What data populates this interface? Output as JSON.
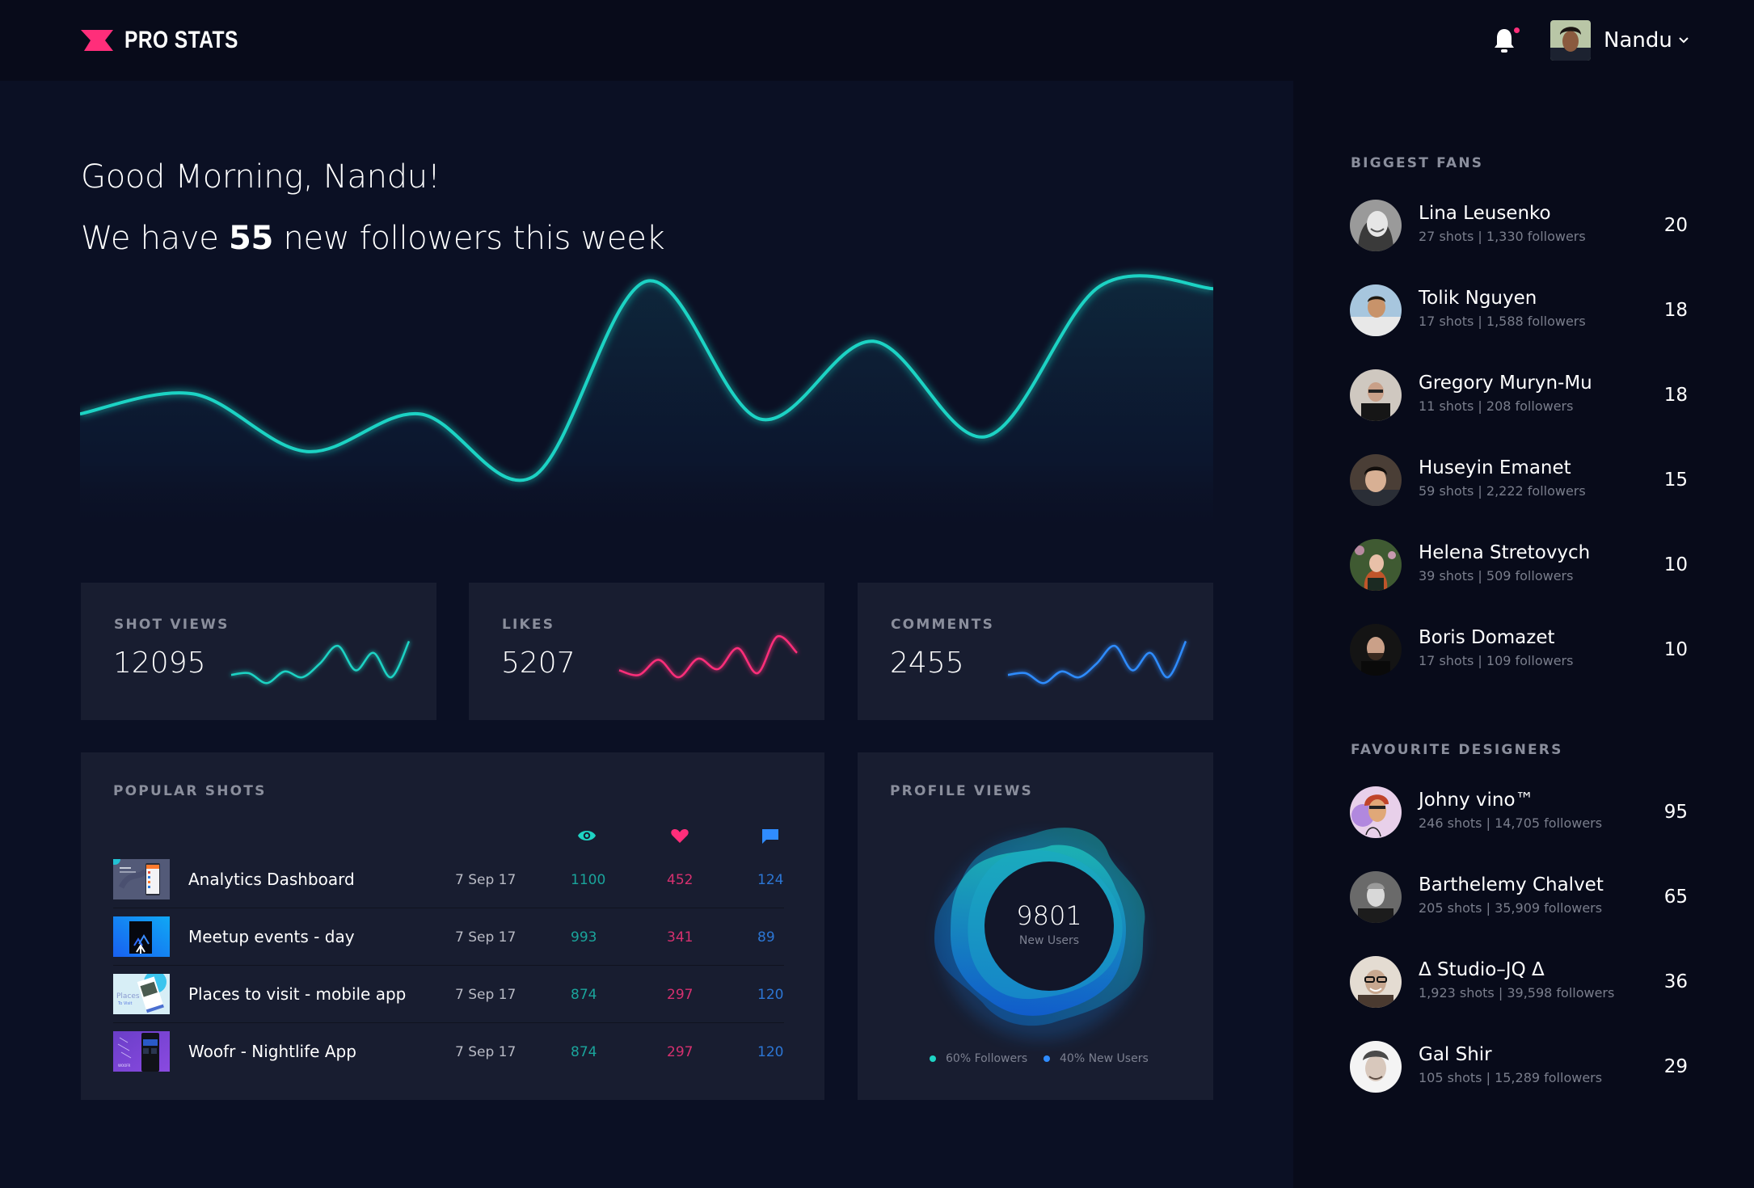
{
  "header": {
    "brand": "PRO STATS",
    "user_name": "Nandu",
    "notification_dot": true,
    "colors": {
      "brand": "#ff2e7a"
    }
  },
  "greeting": {
    "line1": "Good Morning, Nandu!",
    "line2_prefix": "We have ",
    "line2_count": "55",
    "line2_suffix": " new followers this week"
  },
  "chart_data": [
    {
      "type": "line",
      "title": "",
      "xlabel": "",
      "ylabel": "",
      "grid": false,
      "x": [
        0,
        1,
        2,
        3,
        4,
        5,
        6,
        7,
        8,
        9,
        10
      ],
      "series": [
        {
          "name": "New followers",
          "color": "#1ed3c4",
          "values": [
            38,
            46,
            23,
            38,
            13,
            91,
            36,
            67,
            29,
            89,
            88
          ]
        }
      ],
      "ylim": [
        0,
        100
      ]
    },
    {
      "type": "line",
      "title": "SHOT VIEWS",
      "series": [
        {
          "name": "Shot views",
          "color": "#1ed3c4",
          "values": [
            22,
            25,
            8,
            28,
            18,
            42,
            72,
            30,
            60,
            18,
            80
          ]
        }
      ],
      "ylim": [
        0,
        100
      ]
    },
    {
      "type": "line",
      "title": "LIKES",
      "series": [
        {
          "name": "Likes",
          "color": "#ff2e7a",
          "values": [
            30,
            22,
            48,
            18,
            50,
            32,
            68,
            25,
            88,
            60
          ]
        }
      ],
      "ylim": [
        0,
        100
      ]
    },
    {
      "type": "line",
      "title": "COMMENTS",
      "series": [
        {
          "name": "Comments",
          "color": "#2f8cff",
          "values": [
            22,
            25,
            8,
            28,
            18,
            42,
            72,
            30,
            60,
            18,
            80
          ]
        }
      ],
      "ylim": [
        0,
        100
      ]
    },
    {
      "type": "pie",
      "title": "PROFILE VIEWS",
      "categories": [
        "Followers",
        "New Users"
      ],
      "values": [
        60,
        40
      ],
      "center_value": "9801",
      "center_label": "New Users"
    }
  ],
  "stats": [
    {
      "label": "SHOT VIEWS",
      "value": "12095",
      "color": "#1ed3c4"
    },
    {
      "label": "LIKES",
      "value": "5207",
      "color": "#ff2e7a"
    },
    {
      "label": "COMMENTS",
      "value": "2455",
      "color": "#2f8cff"
    }
  ],
  "popular_shots": {
    "title": "POPULAR SHOTS",
    "columns": [
      "views-icon",
      "likes-icon",
      "comments-icon"
    ],
    "rows": [
      {
        "title": "Analytics Dashboard",
        "date": "7 Sep 17",
        "views": "1100",
        "likes": "452",
        "comments": "124"
      },
      {
        "title": "Meetup events - day",
        "date": "7 Sep 17",
        "views": "993",
        "likes": "341",
        "comments": "89"
      },
      {
        "title": "Places to visit - mobile app",
        "date": "7 Sep 17",
        "views": "874",
        "likes": "297",
        "comments": "120"
      },
      {
        "title": "Woofr - Nightlife App",
        "date": "7 Sep 17",
        "views": "874",
        "likes": "297",
        "comments": "120"
      }
    ],
    "thumb_texts": {
      "places": "Places",
      "places_sub": "To Visit",
      "woofr": "WOOFR"
    }
  },
  "profile_views": {
    "title": "PROFILE VIEWS",
    "value": "9801",
    "sublabel": "New Users",
    "legend": [
      {
        "label": "60% Followers",
        "color": "#1ed3c4"
      },
      {
        "label": "40% New Users",
        "color": "#2f8cff"
      }
    ]
  },
  "sidebar": {
    "fans_title": "BIGGEST FANS",
    "fans": [
      {
        "name": "Lina Leusenko",
        "meta": "27 shots | 1,330 followers",
        "count": "20"
      },
      {
        "name": "Tolik Nguyen",
        "meta": "17 shots | 1,588 followers",
        "count": "18"
      },
      {
        "name": "Gregory Muryn-Mu",
        "meta": "11 shots | 208 followers",
        "count": "18"
      },
      {
        "name": "Huseyin Emanet",
        "meta": "59 shots | 2,222 followers",
        "count": "15"
      },
      {
        "name": "Helena Stretovych",
        "meta": "39 shots | 509 followers",
        "count": "10"
      },
      {
        "name": "Boris Domazet",
        "meta": "17 shots | 109 followers",
        "count": "10"
      }
    ],
    "designers_title": "FAVOURITE DESIGNERS",
    "designers": [
      {
        "name": "Johny vino™",
        "meta": "246 shots | 14,705 followers",
        "count": "95"
      },
      {
        "name": "Barthelemy Chalvet",
        "meta": "205 shots | 35,909 followers",
        "count": "65"
      },
      {
        "name": "Δ Studio–JQ Δ",
        "meta": "1,923 shots | 39,598 followers",
        "count": "36"
      },
      {
        "name": "Gal Shir",
        "meta": "105 shots | 15,289 followers",
        "count": "29"
      }
    ]
  }
}
